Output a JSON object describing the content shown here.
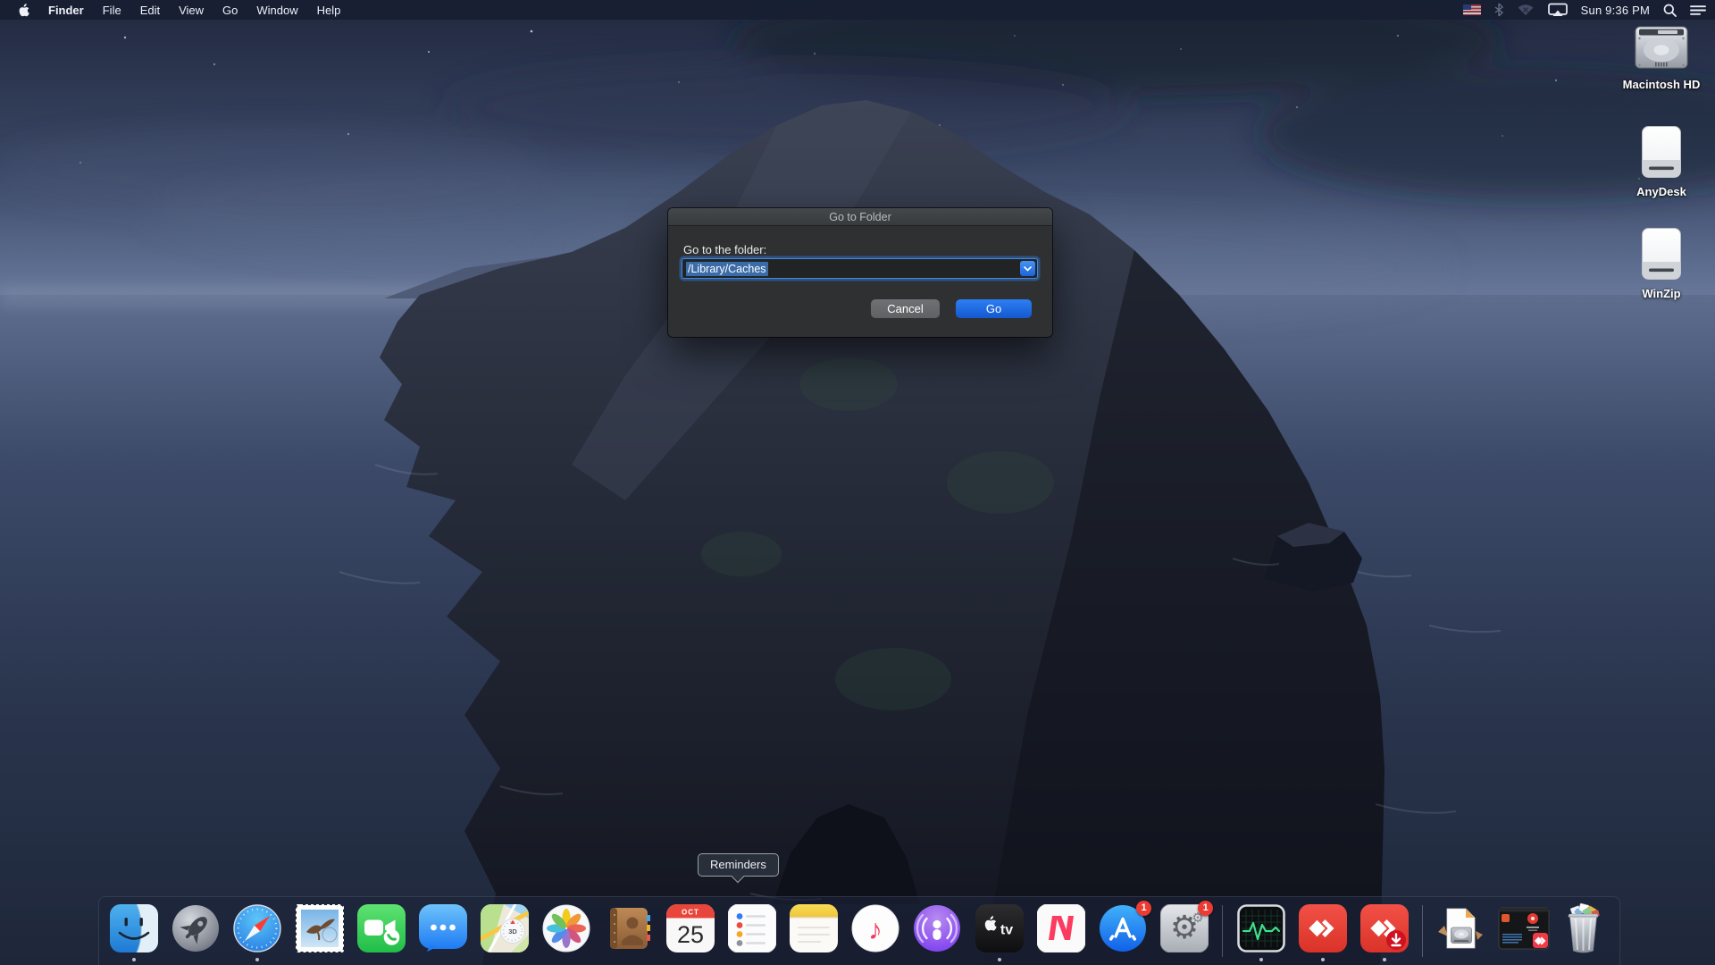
{
  "menu_bar": {
    "items": [
      {
        "label": "Finder",
        "bold": true
      },
      {
        "label": "File"
      },
      {
        "label": "Edit"
      },
      {
        "label": "View"
      },
      {
        "label": "Go"
      },
      {
        "label": "Window"
      },
      {
        "label": "Help"
      }
    ],
    "time": "Sun 9:36 PM",
    "status_icons": [
      "us-flag-icon",
      "bluetooth-icon",
      "wifi-off-icon",
      "screen-mirroring-icon",
      "spotlight-search-icon",
      "notification-center-icon"
    ]
  },
  "icons_map": {
    "apple-icon": "",
    "us-flag-icon": "⚑",
    "bluetooth-icon": "ᛒ",
    "wifi-off-icon": "📶",
    "screen-mirroring-icon": "🖵",
    "spotlight-search-icon": "🔍",
    "notification-center-icon": "☰",
    "chevron-down-icon": "⌄"
  },
  "desktop_icons": [
    {
      "label": "Macintosh HD",
      "type": "internal-drive"
    },
    {
      "label": "AnyDesk",
      "type": "external-drive"
    },
    {
      "label": "WinZip",
      "type": "external-drive"
    }
  ],
  "dialog": {
    "title": "Go to Folder",
    "label": "Go to the folder:",
    "input_value": "/Library/Caches",
    "cancel_label": "Cancel",
    "go_label": "Go",
    "accent_color": "#2e7ef2",
    "focus_ring_color": "#3f87de"
  },
  "tooltip": {
    "text": "Reminders"
  },
  "dock": {
    "items": [
      {
        "name": "Finder",
        "running": true
      },
      {
        "name": "Launchpad",
        "running": false
      },
      {
        "name": "Safari",
        "running": true
      },
      {
        "name": "Mail",
        "running": false
      },
      {
        "name": "FaceTime",
        "running": false
      },
      {
        "name": "Messages",
        "running": false
      },
      {
        "name": "Maps",
        "running": false,
        "compass_label": "3D"
      },
      {
        "name": "Photos",
        "running": false
      },
      {
        "name": "Contacts",
        "running": false
      },
      {
        "name": "Calendar",
        "running": false,
        "month": "OCT",
        "day": "25"
      },
      {
        "name": "Reminders",
        "running": false
      },
      {
        "name": "Notes",
        "running": false
      },
      {
        "name": "Music",
        "running": false
      },
      {
        "name": "Podcasts",
        "running": false
      },
      {
        "name": "Apple TV",
        "running": true,
        "label": "tv"
      },
      {
        "name": "News",
        "running": false
      },
      {
        "name": "App Store",
        "running": false,
        "badge": "1"
      },
      {
        "name": "System Preferences",
        "running": false,
        "badge": "1"
      },
      {
        "name": "Activity Monitor",
        "running": true
      },
      {
        "name": "AnyDesk",
        "running": true
      },
      {
        "name": "AnyDesk Installer",
        "running": true
      },
      {
        "name": "Disk Image File",
        "running": false
      },
      {
        "name": "Minimized AnyDesk Window",
        "running": false
      },
      {
        "name": "Trash",
        "running": false
      }
    ]
  }
}
